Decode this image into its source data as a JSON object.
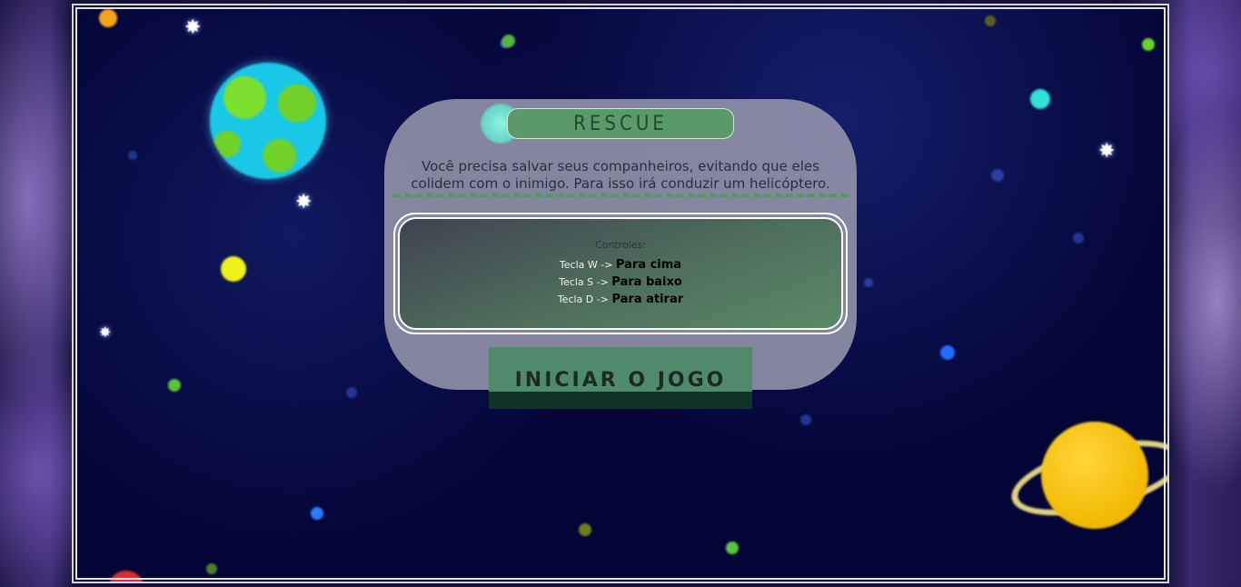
{
  "game": {
    "title": "RESCUE",
    "description": "Você precisa salvar seus companheiros, evitando que eles colidem com o inimigo. Para isso irá conduzir um helicóptero.",
    "controls": {
      "title": "Controles:",
      "items": [
        {
          "key": "Tecla W ->",
          "action": "Para cima"
        },
        {
          "key": "Tecla S ->",
          "action": "Para baixo"
        },
        {
          "key": "Tecla D ->",
          "action": "Para atirar"
        }
      ]
    },
    "start_button": "INICIAR O JOGO"
  },
  "colors": {
    "panel": "#a0a0b2",
    "accent_green": "#4f8a6a",
    "space_bg": "#030536"
  },
  "icons": [
    "planet-earth-icon",
    "planet-saturn-icon",
    "star-icon"
  ]
}
